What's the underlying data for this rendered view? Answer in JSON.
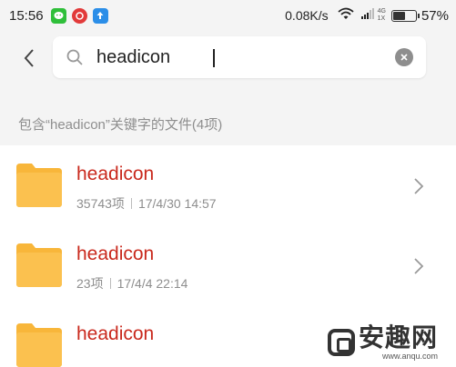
{
  "status_bar": {
    "time": "15:56",
    "notifications": [
      "wechat-icon",
      "netease-music-icon",
      "upload-icon"
    ],
    "network_speed": "0.08K/s",
    "net_type_top": "4G",
    "net_type_bottom": "1X",
    "battery_percent": "57%",
    "battery_level": 0.57
  },
  "search": {
    "query": "headicon",
    "back_icon": "chevron-left-icon",
    "search_icon": "search-icon",
    "clear_icon": "clear-icon"
  },
  "result_summary": "包含“headicon”关键字的文件(4项)",
  "results": [
    {
      "title": "headicon",
      "count": "35743项",
      "date": "17/4/30 14:57"
    },
    {
      "title": "headicon",
      "count": "23项",
      "date": "17/4/4 22:14"
    },
    {
      "title": "headicon",
      "count": "",
      "date": ""
    }
  ],
  "watermark": {
    "name": "安趣网",
    "url": "www.anqu.com"
  },
  "colors": {
    "accent_red": "#c9291d",
    "folder_yellow": "#f8b63a",
    "background_gray": "#f4f4f4",
    "secondary_text": "#8e8e8e"
  }
}
